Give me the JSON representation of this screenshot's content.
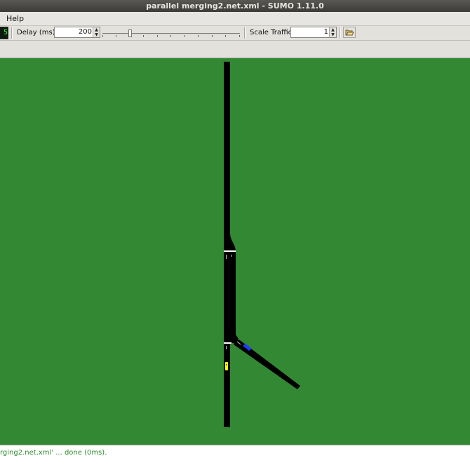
{
  "window": {
    "title": "parallel merging2.net.xml - SUMO 1.11.0"
  },
  "menubar": {
    "help_label": "Help"
  },
  "toolbar": {
    "clock_text": "5",
    "delay_label": "Delay (ms):",
    "delay_value": "200",
    "scale_traffic_label": "Scale Traffic:",
    "scale_traffic_value": "1",
    "delay_slider_fraction": 0.2
  },
  "status": {
    "message": "rging2.net.xml' ... done (0ms)."
  },
  "icons": [
    "clock-display-icon",
    "spin-arrows-icon",
    "open-folder-icon"
  ],
  "colors": {
    "canvas_background": "#338833",
    "road": "#000000",
    "status_text": "#2e8b2e",
    "vehicle_yellow": "#ffff00",
    "vehicle_blue": "#1e3cff"
  }
}
